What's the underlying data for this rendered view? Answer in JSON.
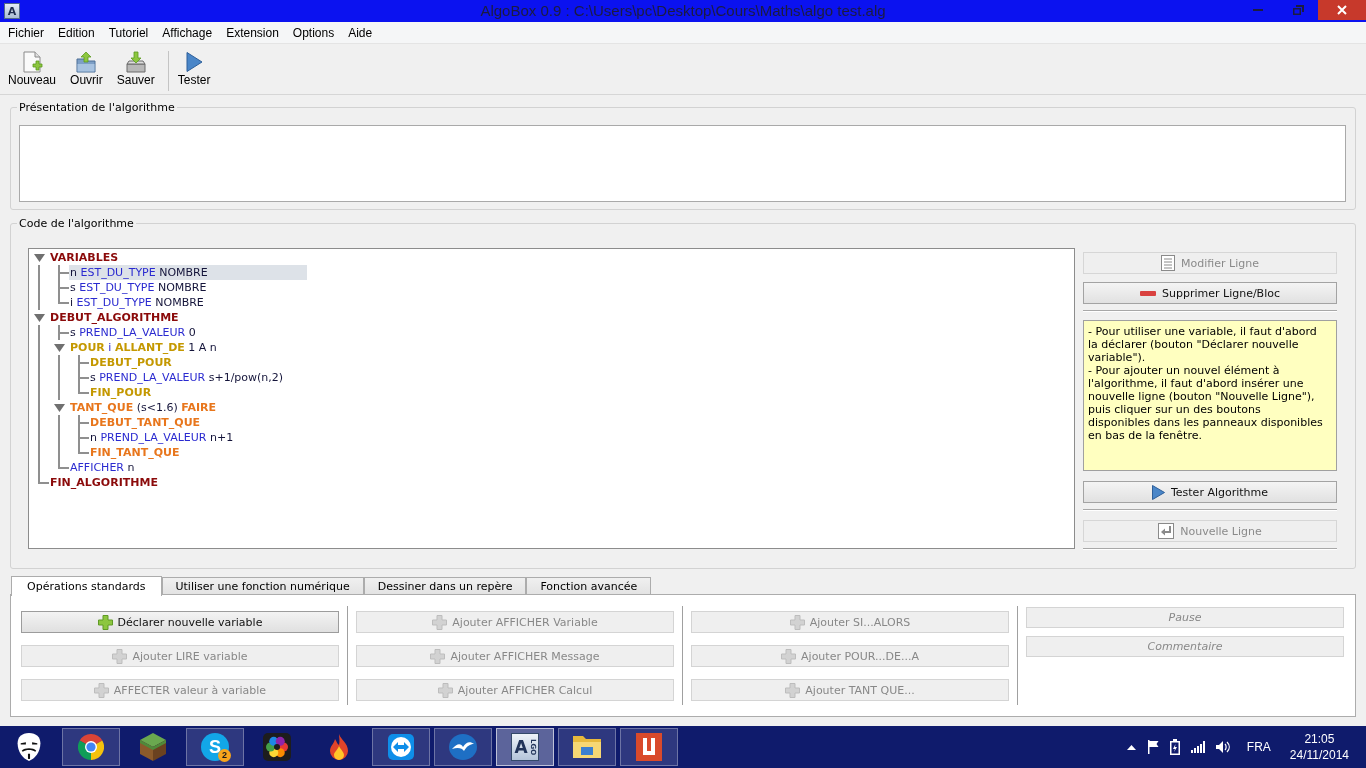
{
  "window": {
    "icon_glyph": "A",
    "title": "AlgoBox 0.9 : C:\\Users\\pc\\Desktop\\Cours\\Maths\\algo test.alg"
  },
  "menu": [
    "Fichier",
    "Edition",
    "Tutoriel",
    "Affichage",
    "Extension",
    "Options",
    "Aide"
  ],
  "toolbar": [
    {
      "kind": "new",
      "label": "Nouveau"
    },
    {
      "kind": "open",
      "label": "Ouvrir"
    },
    {
      "kind": "save",
      "label": "Sauver"
    },
    {
      "kind": "run",
      "label": "Tester"
    }
  ],
  "presentation": {
    "title": "Présentation de l'algorithme"
  },
  "code": {
    "title": "Code de l'algorithme",
    "tree": [
      {
        "segments": [
          {
            "kind": "block",
            "text": "VARIABLES"
          }
        ],
        "selected": false,
        "expanded": true,
        "children": [
          {
            "segments": [
              {
                "kind": "plain",
                "text": "n"
              },
              {
                "kind": "keyword",
                "text": "EST_DU_TYPE"
              },
              {
                "kind": "plain",
                "text": "NOMBRE"
              }
            ],
            "selected": true
          },
          {
            "segments": [
              {
                "kind": "plain",
                "text": "s"
              },
              {
                "kind": "keyword",
                "text": "EST_DU_TYPE"
              },
              {
                "kind": "plain",
                "text": "NOMBRE"
              }
            ],
            "selected": false
          },
          {
            "segments": [
              {
                "kind": "plain",
                "text": "i"
              },
              {
                "kind": "keyword",
                "text": "EST_DU_TYPE"
              },
              {
                "kind": "plain",
                "text": "NOMBRE"
              }
            ],
            "selected": false
          }
        ]
      },
      {
        "segments": [
          {
            "kind": "block",
            "text": "DEBUT_ALGORITHME"
          }
        ],
        "selected": false,
        "expanded": true,
        "children": [
          {
            "segments": [
              {
                "kind": "plain",
                "text": "s"
              },
              {
                "kind": "keyword",
                "text": "PREND_LA_VALEUR"
              },
              {
                "kind": "plain",
                "text": "0"
              }
            ],
            "selected": false
          },
          {
            "segments": [
              {
                "kind": "loop",
                "text": "POUR"
              },
              {
                "kind": "keyword",
                "text": "i"
              },
              {
                "kind": "loop",
                "text": "ALLANT_DE"
              },
              {
                "kind": "plain",
                "text": "1 A n"
              }
            ],
            "selected": false,
            "expanded": true,
            "children": [
              {
                "segments": [
                  {
                    "kind": "loop",
                    "text": "DEBUT_POUR"
                  }
                ],
                "selected": false
              },
              {
                "segments": [
                  {
                    "kind": "plain",
                    "text": "s"
                  },
                  {
                    "kind": "keyword",
                    "text": "PREND_LA_VALEUR"
                  },
                  {
                    "kind": "plain",
                    "text": "s+1/pow(n,2)"
                  }
                ],
                "selected": false
              },
              {
                "segments": [
                  {
                    "kind": "loop",
                    "text": "FIN_POUR"
                  }
                ],
                "selected": false
              }
            ]
          },
          {
            "segments": [
              {
                "kind": "while",
                "text": "TANT_QUE"
              },
              {
                "kind": "plain",
                "text": "(s<1.6)"
              },
              {
                "kind": "while",
                "text": "FAIRE"
              }
            ],
            "selected": false,
            "expanded": true,
            "children": [
              {
                "segments": [
                  {
                    "kind": "while",
                    "text": "DEBUT_TANT_QUE"
                  }
                ],
                "selected": false
              },
              {
                "segments": [
                  {
                    "kind": "plain",
                    "text": "n"
                  },
                  {
                    "kind": "keyword",
                    "text": "PREND_LA_VALEUR"
                  },
                  {
                    "kind": "plain",
                    "text": "n+1"
                  }
                ],
                "selected": false
              },
              {
                "segments": [
                  {
                    "kind": "while",
                    "text": "FIN_TANT_QUE"
                  }
                ],
                "selected": false
              }
            ]
          },
          {
            "segments": [
              {
                "kind": "keyword",
                "text": "AFFICHER"
              },
              {
                "kind": "plain",
                "text": "n"
              }
            ],
            "selected": false
          }
        ]
      },
      {
        "segments": [
          {
            "kind": "block",
            "text": "FIN_ALGORITHME"
          }
        ],
        "selected": false
      }
    ],
    "side": [
      {
        "kind": "edit",
        "label": "Modifier Ligne",
        "disabled": true
      },
      {
        "kind": "delete",
        "label": "Supprimer Ligne/Bloc",
        "disabled": false
      },
      {
        "kind": "help",
        "paragraphs": [
          "- Pour utiliser une variable, il faut d'abord la déclarer (bouton \"Déclarer nouvelle variable\").",
          "- Pour ajouter un nouvel élément à l'algorithme, il faut d'abord insérer une nouvelle ligne (bouton \"Nouvelle Ligne\"), puis cliquer sur un des boutons disponibles dans les panneaux disponibles en bas de la fenêtre."
        ]
      },
      {
        "kind": "run",
        "label": "Tester Algorithme",
        "disabled": false
      },
      {
        "kind": "insert",
        "label": "Nouvelle Ligne",
        "disabled": true
      }
    ]
  },
  "operations": {
    "tabs": [
      {
        "label": "Opérations standards",
        "selected": true
      },
      {
        "label": "Utiliser une fonction numérique",
        "selected": false
      },
      {
        "label": "Dessiner dans un repère",
        "selected": false
      },
      {
        "label": "Fonction avancée",
        "selected": false
      }
    ],
    "columns": [
      [
        {
          "kind": "add",
          "label": "Déclarer nouvelle variable",
          "disabled": false
        },
        {
          "kind": "add",
          "label": "Ajouter LIRE variable",
          "disabled": true
        },
        {
          "kind": "add",
          "label": "AFFECTER valeur à variable",
          "disabled": true
        }
      ],
      [
        {
          "kind": "add",
          "label": "Ajouter AFFICHER Variable",
          "disabled": true
        },
        {
          "kind": "add",
          "label": "Ajouter AFFICHER Message",
          "disabled": true
        },
        {
          "kind": "add",
          "label": "Ajouter AFFICHER Calcul",
          "disabled": true
        }
      ],
      [
        {
          "kind": "add",
          "label": "Ajouter SI...ALORS",
          "disabled": true
        },
        {
          "kind": "add",
          "label": "Ajouter POUR...DE...A",
          "disabled": true
        },
        {
          "kind": "add",
          "label": "Ajouter TANT QUE...",
          "disabled": true
        }
      ],
      [
        {
          "kind": "plain",
          "label": "Pause",
          "disabled": true
        },
        {
          "kind": "plain",
          "label": "Commentaire",
          "disabled": true
        }
      ]
    ]
  },
  "taskbar": {
    "apps": [
      {
        "kind": "mask",
        "open": false,
        "selected": false
      },
      {
        "kind": "browser",
        "open": true,
        "selected": false
      },
      {
        "kind": "block",
        "open": false,
        "selected": false
      },
      {
        "kind": "chat",
        "open": true,
        "selected": false,
        "glyph": "S",
        "badge": "2"
      },
      {
        "kind": "petals",
        "open": false,
        "selected": false
      },
      {
        "kind": "flame",
        "open": false,
        "selected": false
      },
      {
        "kind": "remote",
        "open": true,
        "selected": false
      },
      {
        "kind": "gull",
        "open": true,
        "selected": false
      },
      {
        "kind": "algobox",
        "open": true,
        "selected": true,
        "glyph": "A",
        "sub": "LGO"
      },
      {
        "kind": "folder",
        "open": true,
        "selected": false
      },
      {
        "kind": "tile",
        "open": true,
        "selected": false
      }
    ],
    "language": "FRA",
    "time": "21:05",
    "date": "24/11/2014"
  }
}
